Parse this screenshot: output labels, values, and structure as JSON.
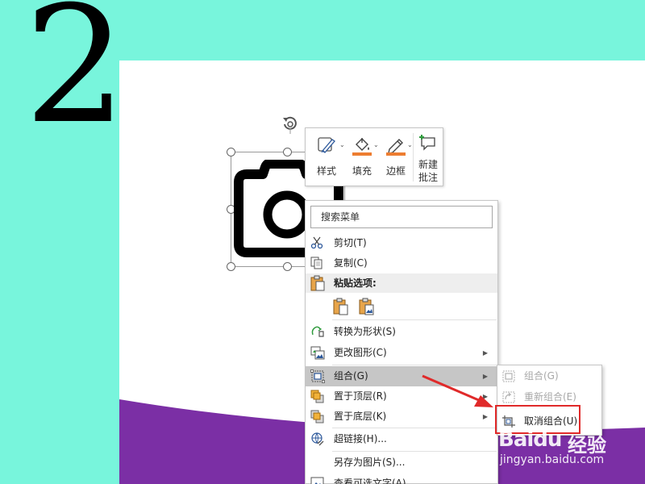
{
  "step_number": "2",
  "colors": {
    "background": "#78f5dc",
    "slide": "#ffffff",
    "slide_wave": "#7b2fa5",
    "menu_hover": "#c6c6c6",
    "highlight_box": "#e02a2a",
    "arrow": "#e02a2a",
    "fill_bar": "#ed7d31"
  },
  "mini_toolbar": {
    "style_label": "样式",
    "fill_label": "填充",
    "border_label": "边框",
    "new_comment_line1": "新建",
    "new_comment_line2": "批注"
  },
  "context_menu": {
    "search_placeholder": "搜索菜单",
    "cut": "剪切(T)",
    "copy": "复制(C)",
    "paste_options": "粘贴选项:",
    "convert_to_shape": "转换为形状(S)",
    "change_picture": "更改图形(C)",
    "group": "组合(G)",
    "bring_to_front": "置于顶层(R)",
    "send_to_back": "置于底层(K)",
    "hyperlink": "超链接(H)...",
    "save_as_picture": "另存为图片(S)...",
    "alt_text": "查看可选文字(A)..."
  },
  "group_submenu": {
    "group": "组合(G)",
    "regroup": "重新组合(E)",
    "ungroup": "取消组合(U)"
  },
  "watermark": {
    "brand": "Baidu",
    "brand_cn": "经验",
    "url": "jingyan.baidu.com"
  }
}
